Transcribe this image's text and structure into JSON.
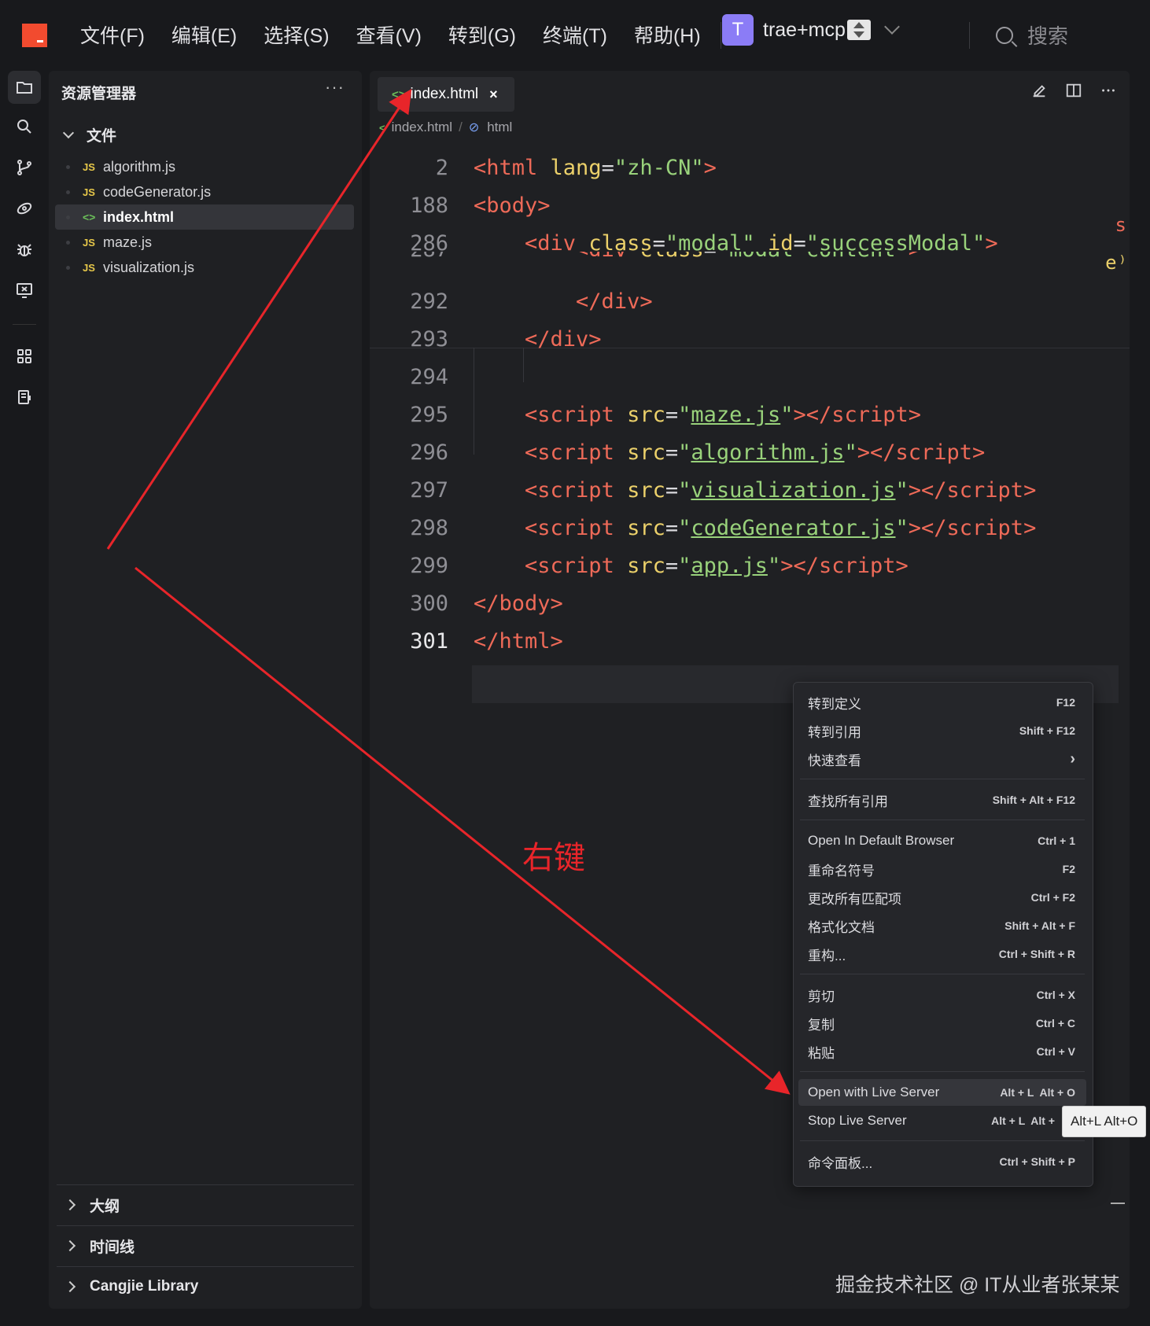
{
  "titlebar": {
    "menus": [
      "文件(F)",
      "编辑(E)",
      "选择(S)",
      "查看(V)",
      "转到(G)",
      "终端(T)",
      "帮助(H)"
    ],
    "project_initial": "T",
    "project_name": "trae+mcp",
    "search_label": "搜索"
  },
  "explorer": {
    "title": "资源管理器",
    "more": "···",
    "folder": "文件",
    "files": [
      {
        "icon": "JS",
        "name": "algorithm.js"
      },
      {
        "icon": "<>",
        "name": "codeGenerator.js"
      },
      {
        "icon": "<>",
        "name": "index.html"
      },
      {
        "icon": "JS",
        "name": "maze.js"
      },
      {
        "icon": "JS",
        "name": "visualization.js"
      }
    ],
    "sections": [
      "大纲",
      "时间线",
      "Cangjie Library"
    ]
  },
  "editor": {
    "tab_icon": "<>",
    "tab_label": "index.html",
    "tab_close": "×",
    "breadcrumb": [
      "index.html",
      "html"
    ],
    "lines": [
      {
        "n": "2"
      },
      {
        "n": "188"
      },
      {
        "n": "286"
      },
      {
        "n": "287"
      },
      {
        "n": "292"
      },
      {
        "n": "293"
      },
      {
        "n": "294"
      },
      {
        "n": "295"
      },
      {
        "n": "296"
      },
      {
        "n": "297"
      },
      {
        "n": "298"
      },
      {
        "n": "299"
      },
      {
        "n": "300"
      },
      {
        "n": "301"
      }
    ],
    "scripts": [
      "maze.js",
      "algorithm.js",
      "visualization.js",
      "codeGenerator.js",
      "app.js"
    ],
    "lang": "zh-CN",
    "modal_class": "modal",
    "modal_id": "successModal",
    "content_class": "modal-content",
    "edge_chars": [
      "s",
      "e⁾"
    ]
  },
  "context_menu": {
    "items": [
      {
        "label": "转到定义",
        "keys": "F12"
      },
      {
        "label": "转到引用",
        "keys": "Shift + F12"
      },
      {
        "label": "快速查看",
        "keys": "›"
      },
      {
        "label": "查找所有引用",
        "keys": "Shift + Alt + F12"
      },
      {
        "label": "Open In Default Browser",
        "keys": "Ctrl + 1"
      },
      {
        "label": "重命名符号",
        "keys": "F2"
      },
      {
        "label": "更改所有匹配项",
        "keys": "Ctrl + F2"
      },
      {
        "label": "格式化文档",
        "keys": "Shift + Alt + F"
      },
      {
        "label": "重构...",
        "keys": "Ctrl + Shift + R"
      },
      {
        "label": "剪切",
        "keys": "Ctrl + X"
      },
      {
        "label": "复制",
        "keys": "Ctrl + C"
      },
      {
        "label": "粘贴",
        "keys": "Ctrl + V"
      },
      {
        "label": "Open with Live Server",
        "keys": "Alt + L  Alt + O"
      },
      {
        "label": "Stop Live Server",
        "keys": "Alt + L  Alt +"
      },
      {
        "label": "命令面板...",
        "keys": "Ctrl + Shift + P"
      }
    ],
    "tooltip": "Alt+L Alt+O"
  },
  "annotation": "右键",
  "watermark": "掘金技术社区 @ IT从业者张某某",
  "colors": {
    "accent_red": "#e8252a",
    "tag": "#ee6a58",
    "attr": "#ebd06a",
    "string": "#99d27b",
    "logo": "#f24b2f",
    "avatar": "#8b7cf6"
  }
}
